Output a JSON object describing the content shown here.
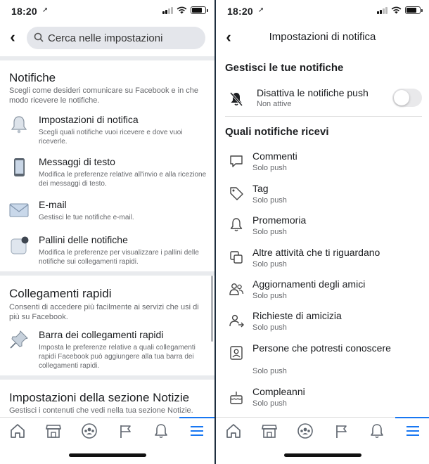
{
  "status_bar": {
    "time": "18:20"
  },
  "left": {
    "search": {
      "placeholder": "Cerca nelle impostazioni"
    },
    "sections": {
      "notifiche": {
        "title": "Notifiche",
        "description": "Scegli come desideri comunicare su Facebook e in che modo ricevere le notifiche.",
        "items": [
          {
            "title": "Impostazioni di notifica",
            "description": "Scegli quali notifiche vuoi ricevere e dove vuoi riceverle.",
            "icon": "bell-icon"
          },
          {
            "title": "Messaggi di testo",
            "description": "Modifica le preferenze relative all'invio e alla ricezione dei messaggi di testo.",
            "icon": "phone-icon"
          },
          {
            "title": "E-mail",
            "description": "Gestisci le tue notifiche e-mail.",
            "icon": "envelope-icon"
          },
          {
            "title": "Pallini delle notifiche",
            "description": "Modifica le preferenze per visualizzare i pallini delle notifiche sui collegamenti rapidi.",
            "icon": "badge-dot-icon"
          }
        ]
      },
      "collegamenti": {
        "title": "Collegamenti rapidi",
        "description": "Consenti di accedere più facilmente ai servizi che usi di più su Facebook.",
        "items": [
          {
            "title": "Barra dei collegamenti rapidi",
            "description": "Imposta le preferenze relative a quali collegamenti rapidi Facebook può aggiungere alla tua barra dei collegamenti rapidi.",
            "icon": "pushpin-icon"
          }
        ]
      },
      "notizie": {
        "title": "Impostazioni della sezione Notizie",
        "description": "Gestisci i contenuti che vedi nella tua sezione Notizie."
      }
    }
  },
  "right": {
    "header_title": "Impostazioni di notifica",
    "manage_heading": "Gestisci le tue notifiche",
    "push": {
      "title": "Disattiva le notifiche push",
      "status": "Non attive",
      "enabled": false
    },
    "receive_heading": "Quali notifiche ricevi",
    "items": [
      {
        "title": "Commenti",
        "sub": "Solo push",
        "icon": "comment-icon"
      },
      {
        "title": "Tag",
        "sub": "Solo push",
        "icon": "tag-icon"
      },
      {
        "title": "Promemoria",
        "sub": "Solo push",
        "icon": "bell-outline-icon"
      },
      {
        "title": "Altre attività che ti riguardano",
        "sub": "Solo push",
        "icon": "stacked-squares-icon"
      },
      {
        "title": "Aggiornamenti degli amici",
        "sub": "Solo push",
        "icon": "friends-icon"
      },
      {
        "title": "Richieste di amicizia",
        "sub": "Solo push",
        "icon": "friend-request-icon"
      },
      {
        "title": "Persone che potresti conoscere",
        "sub": "Solo push",
        "icon": "person-card-icon"
      },
      {
        "title": "Compleanni",
        "sub": "Solo push",
        "icon": "cake-icon"
      }
    ]
  },
  "tabbar": {
    "tabs": [
      "home-icon",
      "marketplace-icon",
      "groups-icon",
      "pages-flag-icon",
      "notifications-bell-icon",
      "menu-icon"
    ],
    "active_index": 5
  },
  "colors": {
    "accent": "#1877f2",
    "text": "#1c1e21",
    "secondary": "#65676b"
  }
}
